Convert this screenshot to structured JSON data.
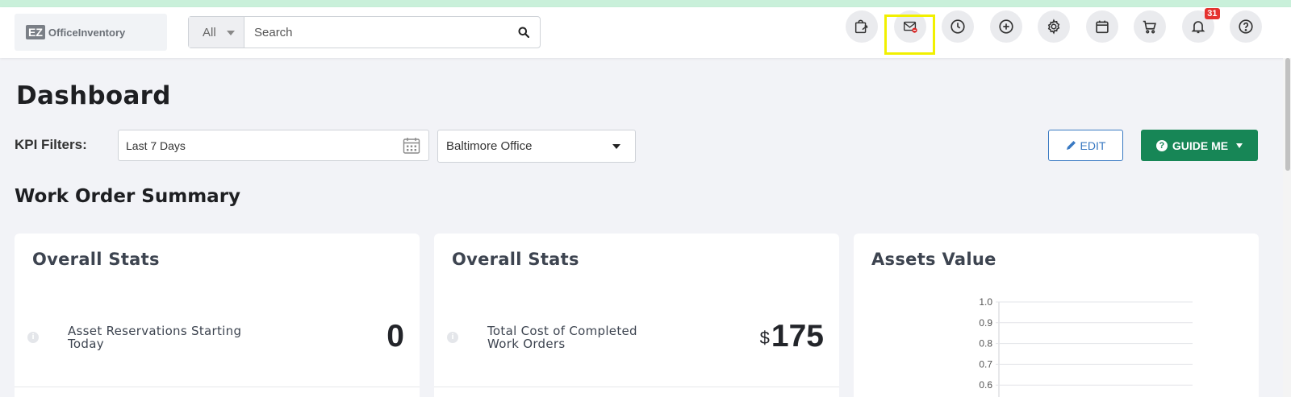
{
  "app": {
    "logo_mark": "EZ",
    "logo_text": "OfficeInventory"
  },
  "search": {
    "scope": "All",
    "placeholder": "Search"
  },
  "header_icons": [
    {
      "name": "checkout-cart-icon"
    },
    {
      "name": "mail-blocked-icon"
    },
    {
      "name": "clock-icon"
    },
    {
      "name": "add-circle-icon"
    },
    {
      "name": "gear-icon"
    },
    {
      "name": "calendar-icon"
    },
    {
      "name": "shopping-cart-icon"
    },
    {
      "name": "bell-icon"
    },
    {
      "name": "help-icon"
    }
  ],
  "notifications": {
    "count": "31"
  },
  "page": {
    "title": "Dashboard"
  },
  "kpi": {
    "label": "KPI Filters:",
    "date_range": "Last 7 Days",
    "location": "Baltimore Office",
    "edit_label": "EDIT",
    "guide_label": "GUIDE ME"
  },
  "section": {
    "title": "Work Order Summary"
  },
  "cards": [
    {
      "title": "Overall Stats",
      "label": "Asset Reservations Starting Today",
      "value": "0",
      "currency": ""
    },
    {
      "title": "Overall Stats",
      "label": "Total Cost of Completed Work Orders",
      "value": "175",
      "currency": "$"
    },
    {
      "title": "Assets Value"
    }
  ],
  "chart_data": {
    "type": "line",
    "title": "",
    "xlabel": "",
    "ylabel": "",
    "ylim": [
      0,
      1.0
    ],
    "y_ticks": [
      "1.0",
      "0.9",
      "0.8",
      "0.7",
      "0.6"
    ],
    "series": [],
    "grid": true
  },
  "colors": {
    "accent_green": "#178656",
    "accent_blue": "#3979c2",
    "badge_red": "#e5322f",
    "highlight": "#f1f000"
  }
}
